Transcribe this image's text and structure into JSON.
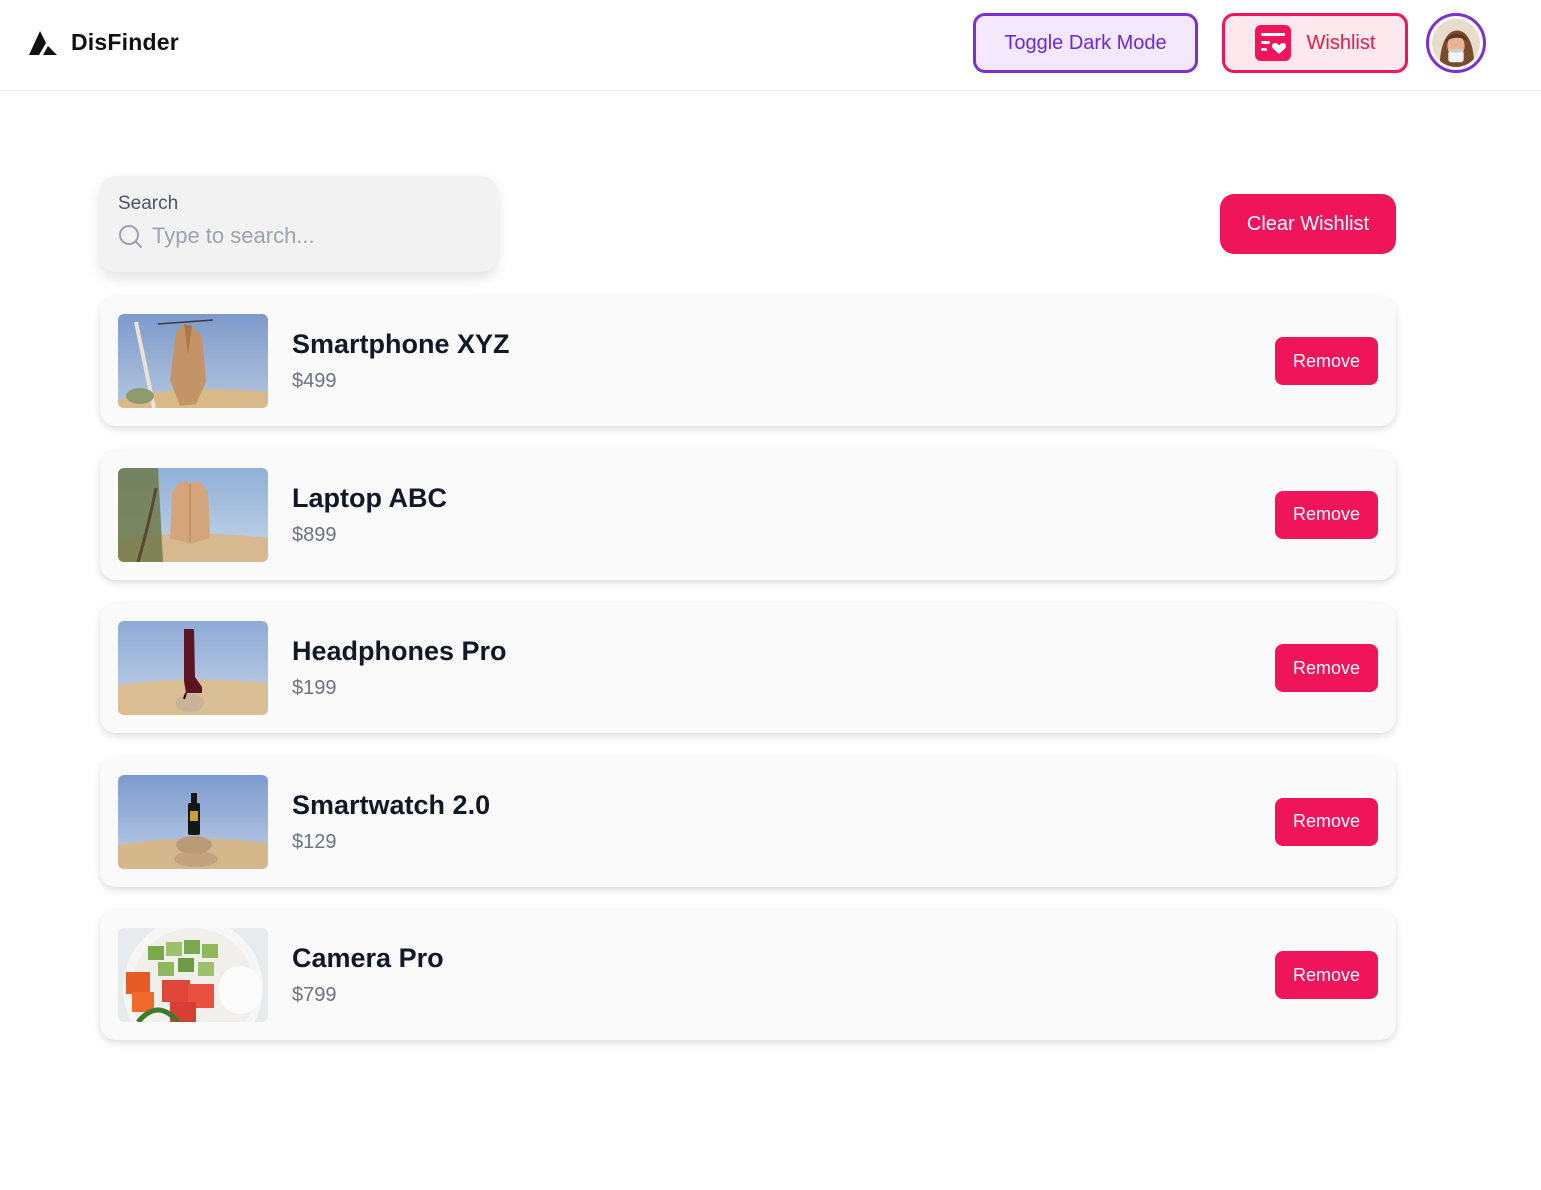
{
  "header": {
    "brand": "DisFinder",
    "toggle_dark_label": "Toggle Dark Mode",
    "wishlist_label": "Wishlist"
  },
  "search": {
    "label": "Search",
    "placeholder": "Type to search...",
    "value": ""
  },
  "actions": {
    "clear_label": "Clear Wishlist"
  },
  "items": [
    {
      "name": "Smartphone XYZ",
      "price": "$499",
      "remove_label": "Remove",
      "image": "coat-on-hanger"
    },
    {
      "name": "Laptop ABC",
      "price": "$899",
      "remove_label": "Remove",
      "image": "jacket-in-tree"
    },
    {
      "name": "Headphones Pro",
      "price": "$199",
      "remove_label": "Remove",
      "image": "boot-on-rock"
    },
    {
      "name": "Smartwatch 2.0",
      "price": "$129",
      "remove_label": "Remove",
      "image": "bottle-on-stone"
    },
    {
      "name": "Camera Pro",
      "price": "$799",
      "remove_label": "Remove",
      "image": "poke-bowl"
    }
  ],
  "colors": {
    "accent_pink": "#f0145a",
    "accent_purple": "#7e2fd0"
  }
}
